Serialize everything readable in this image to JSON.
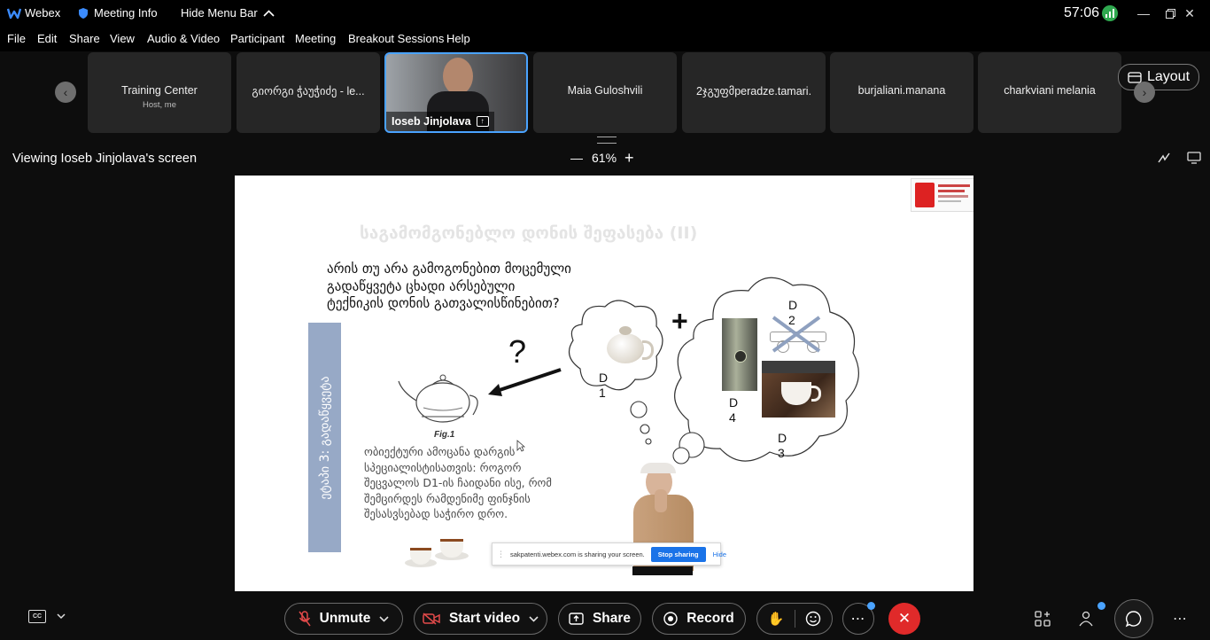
{
  "titlebar": {
    "app_name": "Webex",
    "meeting_info": "Meeting Info",
    "hide_menu": "Hide Menu Bar",
    "timer": "57:06"
  },
  "menu": [
    "File",
    "Edit",
    "Share",
    "View",
    "Audio & Video",
    "Participant",
    "Meeting",
    "Breakout Sessions",
    "Help"
  ],
  "participants": [
    {
      "name": "Training Center",
      "sub": "Host, me"
    },
    {
      "name": "გიორგი ჭაუჭიძე - le..."
    },
    {
      "name": "Ioseb Jinjolava",
      "active": true
    },
    {
      "name": "Maia Guloshvili"
    },
    {
      "name": "2ჯგუფმperadze.tamari."
    },
    {
      "name": "burjaliani.manana"
    },
    {
      "name": "charkviani melania"
    }
  ],
  "layout_label": "Layout",
  "viewing_label": "Viewing Ioseb Jinjolava's screen",
  "zoom": "61%",
  "slide": {
    "title": "საგამომგონებლო დონის შეფასება (II)",
    "question": [
      "არის თუ არა გამოგონებით მოცემული",
      "გადაწყვეტა ცხადი არსებული",
      "ტექნიკის დონის გათვალისწინებით?"
    ],
    "side_label": "ეტაპი 3: გადაწყვეტა",
    "qmark": "?",
    "fig_label": "Fig.1",
    "plus": "+",
    "d1": "D 1",
    "d2": "D 2",
    "d3": "D 3",
    "d4": "D 4",
    "body": [
      "ობიექტური ამოცანა დარგის",
      "სპეციალისტისათვის: როგორ",
      "შეცვალოს D1-ის ჩაიდანი ისე, რომ",
      "შემცირდეს რამდენიმე ფინჯნის",
      "შესასვსებად საჭირო დრო."
    ]
  },
  "share_notice": {
    "text": "sakpatenti.webex.com is sharing your screen.",
    "stop": "Stop sharing",
    "hide": "Hide"
  },
  "controls": {
    "unmute": "Unmute",
    "start_video": "Start video",
    "share": "Share",
    "record": "Record"
  },
  "colors": {
    "active_border": "#4aa3ff",
    "end_button": "#e02a2a",
    "side_band": "#97a9c6",
    "stop_button": "#1a73e8"
  }
}
